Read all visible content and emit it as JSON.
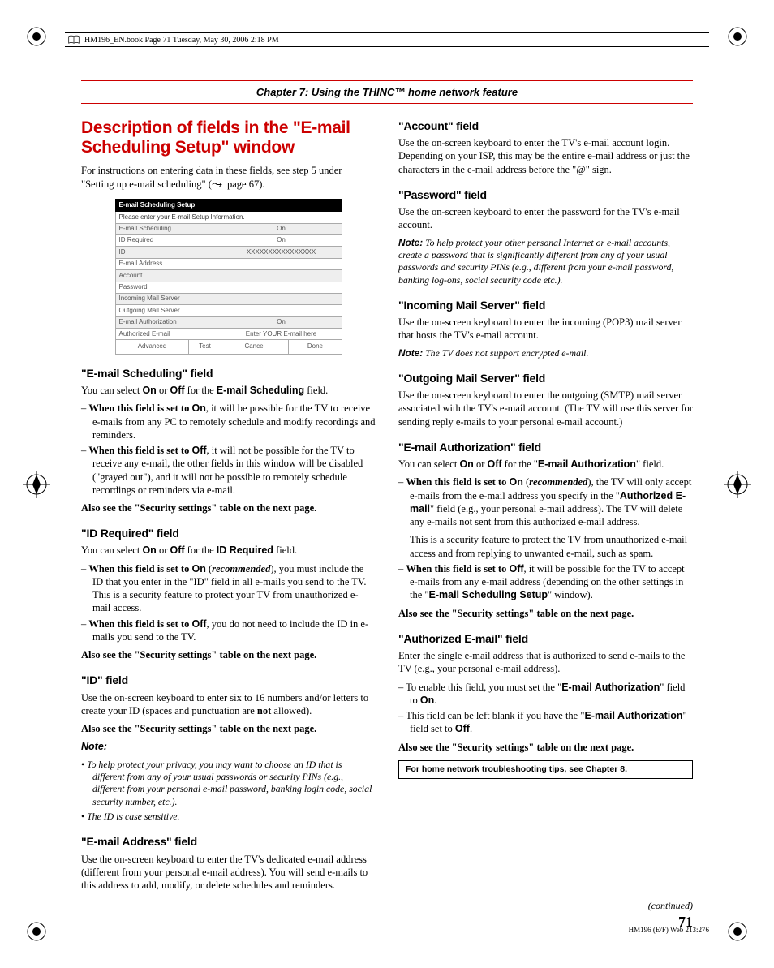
{
  "book_header": "HM196_EN.book  Page 71  Tuesday, May 30, 2006  2:18 PM",
  "chapter_title": "Chapter 7: Using the THINC™ home network feature",
  "main_title": "Description of fields in the \"E-mail Scheduling Setup\" window",
  "intro": "For instructions on entering data in these fields, see step 5 under \"Setting up e-mail scheduling\" (",
  "intro_tail": " page 67).",
  "setup_table": {
    "title": "E-mail Scheduling Setup",
    "instruction": "Please enter your E-mail Setup Information.",
    "rows": [
      {
        "label": "E-mail Scheduling",
        "value": "On"
      },
      {
        "label": "ID Required",
        "value": "On"
      },
      {
        "label": "ID",
        "value": "XXXXXXXXXXXXXXXX"
      },
      {
        "label": "E-mail Address",
        "value": ""
      },
      {
        "label": "Account",
        "value": ""
      },
      {
        "label": "Password",
        "value": ""
      },
      {
        "label": "Incoming Mail Server",
        "value": ""
      },
      {
        "label": "Outgoing Mail Server",
        "value": ""
      },
      {
        "label": "E-mail Authorization",
        "value": "On"
      },
      {
        "label": "Authorized E-mail",
        "value": "Enter YOUR E-mail here"
      }
    ],
    "buttons": [
      "Advanced",
      "Test",
      "Cancel",
      "Done"
    ]
  },
  "left": {
    "s1": {
      "h": "\"E-mail Scheduling\" field",
      "p1a": "You can select ",
      "p1b": " or ",
      "p1c": " for the ",
      "p1d": " field.",
      "on": "On",
      "off": "Off",
      "fieldname": "E-mail Scheduling",
      "li1a": "When this field is set to ",
      "li1b": ", it will be possible for the TV to receive e-mails from any PC to remotely schedule and modify recordings and reminders.",
      "li2a": "When this field is set to ",
      "li2b": ", it will not be possible for the TV to receive any e-mail, the other fields in this window will be disabled (\"grayed out\"), and it will not be possible to remotely schedule recordings or reminders via e-mail.",
      "also": "Also see the \"Security settings\" table on the next page."
    },
    "s2": {
      "h": "\"ID Required\" field",
      "p1a": "You can select ",
      "p1b": " or ",
      "p1c": " for the ",
      "p1d": " field.",
      "on": "On",
      "off": "Off",
      "fieldname": "ID Required",
      "li1a": "When this field is set to ",
      "li1mid": " (",
      "rec": "recommended",
      "li1b": "), you must include the ID that you enter in the \"ID\" field in all e-mails you send to the TV. This is a security feature to protect your TV from unauthorized e-mail access.",
      "li2a": "When this field is set to ",
      "li2b": ", you do not need to include the ID in e-mails you send to the TV.",
      "also": "Also see the \"Security settings\" table on the next page."
    },
    "s3": {
      "h": "\"ID\" field",
      "p1a": "Use the on-screen keyboard to enter six to 16 numbers and/or letters to create your ID (spaces and punctuation are ",
      "not": "not",
      "p1b": " allowed).",
      "also": "Also see the \"Security settings\" table on the next page.",
      "note_label": "Note:",
      "b1": "To help protect your privacy, you may want to choose an ID that is different from any of your usual passwords or security PINs (e.g., different from your personal e-mail password, banking login code, social security number, etc.).",
      "b2": "The ID is case sensitive."
    },
    "s4": {
      "h": "\"E-mail Address\" field",
      "p1": "Use the on-screen keyboard to enter the TV's dedicated e-mail address (different from your personal e-mail address). You will send e-mails to this address to add, modify, or delete schedules and reminders."
    }
  },
  "right": {
    "s5": {
      "h": "\"Account\" field",
      "p1": "Use the on-screen keyboard to enter the TV's e-mail account login. Depending on your ISP, this may be the entire e-mail address or just the characters in the e-mail address before the \"@\" sign."
    },
    "s6": {
      "h": "\"Password\" field",
      "p1": "Use the on-screen keyboard to enter the password for the TV's e-mail account.",
      "note_label": "Note:",
      "note": " To help protect your other personal Internet or e-mail accounts, create a password that is significantly different from any of your usual passwords and security PINs (e.g., different from your e-mail password, banking log-ons, social security code etc.)."
    },
    "s7": {
      "h": "\"Incoming Mail Server\" field",
      "p1": "Use the on-screen keyboard to enter the incoming (POP3) mail server that hosts the TV's e-mail account.",
      "note_label": "Note:",
      "note": " The TV does not support encrypted e-mail."
    },
    "s8": {
      "h": "\"Outgoing Mail Server\" field",
      "p1": "Use the on-screen keyboard to enter the outgoing (SMTP) mail server associated with the TV's e-mail account. (The TV will use this server for sending reply e-mails to your personal e-mail account.)"
    },
    "s9": {
      "h": "\"E-mail Authorization\" field",
      "p1a": "You can select ",
      "on": "On",
      "off": "Off",
      "p1b": " or ",
      "p1c": " for the \"",
      "fieldname": "E-mail Authorization",
      "p1d": "\" field.",
      "li1a": "When this field is set to ",
      "li1mid": " (",
      "rec": "recommended",
      "li1b": "), the TV will only accept e-mails from the e-mail address you specify in the \"",
      "auth": "Authorized E-mail",
      "li1c": "\" field (e.g., your personal e-mail address). The TV will delete any e-mails not sent from this authorized e-mail address.",
      "li1extra": "This is a security feature to protect the TV from unauthorized e-mail access and from replying to unwanted e-mail, such as spam.",
      "li2a": "When this field is set to ",
      "li2b": ", it will be possible for the TV to accept e-mails from any e-mail address (depending on the other settings in the \"",
      "setup": "E-mail Scheduling Setup",
      "li2c": "\" window).",
      "also": "Also see the \"Security settings\" table on the next page."
    },
    "s10": {
      "h": "\"Authorized E-mail\" field",
      "p1": "Enter the single e-mail address that is authorized to send e-mails to the TV (e.g., your personal e-mail address).",
      "li1a": "To enable this field, you must set the \"",
      "auth": "E-mail Authorization",
      "li1b": "\" field  to ",
      "on": "On",
      "li1c": ".",
      "li2a": "This field can be left blank if you have the \"",
      "li2b": "\" field set to ",
      "off": "Off",
      "li2c": ".",
      "also": "Also see the \"Security settings\" table on the next page."
    },
    "tipbox": "For home network troubleshooting tips, see Chapter 8.",
    "continued": "(continued)"
  },
  "page_number": "71",
  "footer_code": "HM196 (E/F) Web 213:276"
}
